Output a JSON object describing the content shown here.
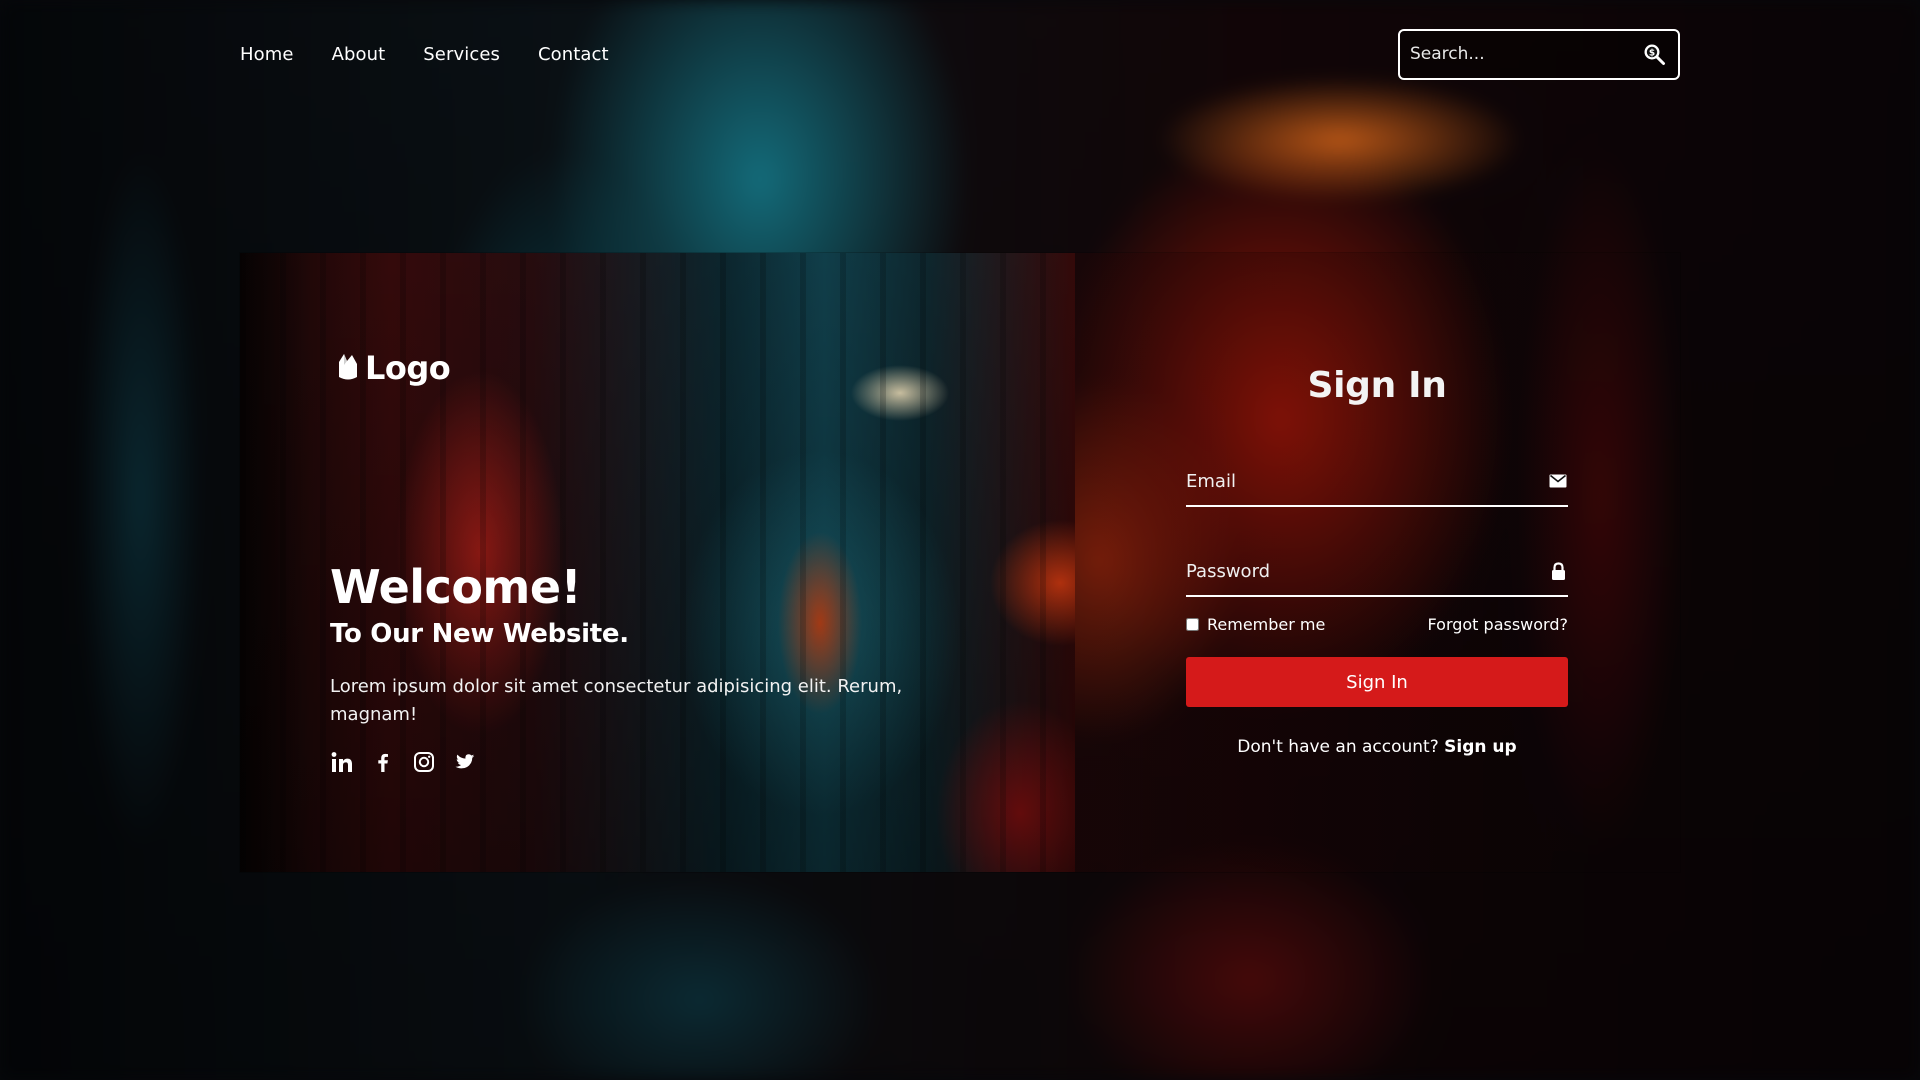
{
  "nav": {
    "links": [
      "Home",
      "About",
      "Services",
      "Contact"
    ],
    "search_placeholder": "Search..."
  },
  "hero": {
    "logo_text": "Logo",
    "welcome": "Welcome!",
    "subtitle": "To Our New Website.",
    "description": "Lorem ipsum dolor sit amet consectetur adipisicing elit. Rerum, magnam!",
    "social_icons": [
      "linkedin-icon",
      "facebook-icon",
      "instagram-icon",
      "twitter-icon"
    ]
  },
  "signin": {
    "title": "Sign In",
    "email_placeholder": "Email",
    "password_placeholder": "Password",
    "remember_label": "Remember me",
    "forgot_label": "Forgot password?",
    "button_label": "Sign In",
    "signup_prompt": "Don't have an account?",
    "signup_link": "Sign up"
  },
  "colors": {
    "accent": "#d51a1a",
    "text": "#ffffff",
    "background": "#07080b"
  }
}
